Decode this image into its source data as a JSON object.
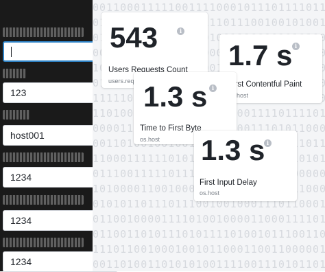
{
  "form": {
    "fields": [
      {
        "value": "",
        "focused": true
      },
      {
        "value": "123"
      },
      {
        "value": "host001"
      },
      {
        "value": "1234"
      },
      {
        "value": "1234"
      },
      {
        "value": "1234"
      }
    ]
  },
  "metrics": [
    {
      "value": "543",
      "title": "Users Requests Count",
      "source": "users.req.count"
    },
    {
      "value": "1.7 s",
      "title": "First Contentful Paint",
      "source": "os.host"
    },
    {
      "value": "1.3 s",
      "title": "Time to First Byte",
      "source": "os.host"
    },
    {
      "value": "1.3 s",
      "title": "First Input Delay",
      "source": "os.host"
    }
  ],
  "icons": {
    "info": "info-icon"
  },
  "colors": {
    "focus_border": "#2f84c8",
    "card_bg": "#ffffff",
    "panel_bg": "#1a1a1a"
  }
}
